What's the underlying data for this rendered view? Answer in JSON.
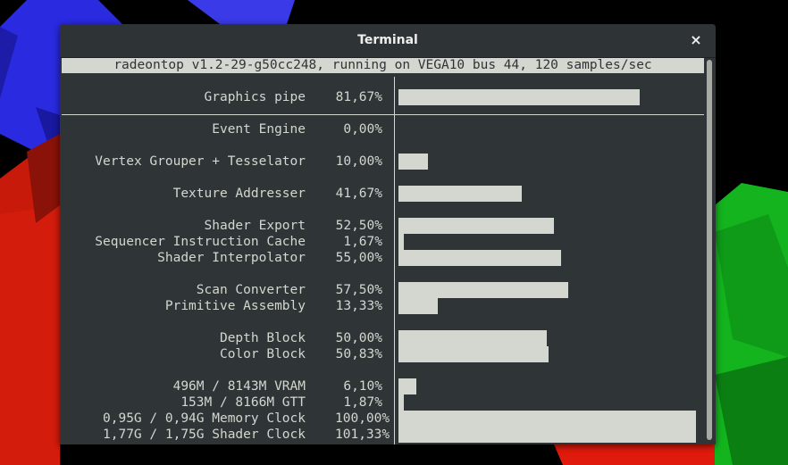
{
  "window": {
    "title": "Terminal",
    "close_icon": "×"
  },
  "terminal": {
    "header": "radeontop v1.2-29-g50cc248, running on VEGA10 bus 44, 120 samples/sec",
    "rows": [
      {
        "label": "Graphics pipe",
        "pct": "81,67%",
        "value": 81.67
      },
      {
        "label": "Event Engine",
        "pct": "0,00%",
        "value": 0.0
      },
      {
        "label": "Vertex Grouper + Tesselator",
        "pct": "10,00%",
        "value": 10.0
      },
      {
        "label": "Texture Addresser",
        "pct": "41,67%",
        "value": 41.67
      },
      {
        "label": "Shader Export",
        "pct": "52,50%",
        "value": 52.5
      },
      {
        "label": "Sequencer Instruction Cache",
        "pct": "1,67%",
        "value": 1.67
      },
      {
        "label": "Shader Interpolator",
        "pct": "55,00%",
        "value": 55.0
      },
      {
        "label": "Scan Converter",
        "pct": "57,50%",
        "value": 57.5
      },
      {
        "label": "Primitive Assembly",
        "pct": "13,33%",
        "value": 13.33
      },
      {
        "label": "Depth Block",
        "pct": "50,00%",
        "value": 50.0
      },
      {
        "label": "Color Block",
        "pct": "50,83%",
        "value": 50.83
      },
      {
        "label": "496M / 8143M VRAM",
        "pct": "6,10%",
        "value": 6.1
      },
      {
        "label": "153M / 8166M GTT",
        "pct": "1,87%",
        "value": 1.87
      },
      {
        "label": "0,95G / 0,94G Memory Clock",
        "pct": "100,00%",
        "value": 100.0
      },
      {
        "label": "1,77G / 1,75G Shader Clock",
        "pct": "101,33%",
        "value": 101.33
      }
    ]
  },
  "colors": {
    "terminal_bg": "#2f3436",
    "terminal_fg": "#d3d7cf"
  }
}
